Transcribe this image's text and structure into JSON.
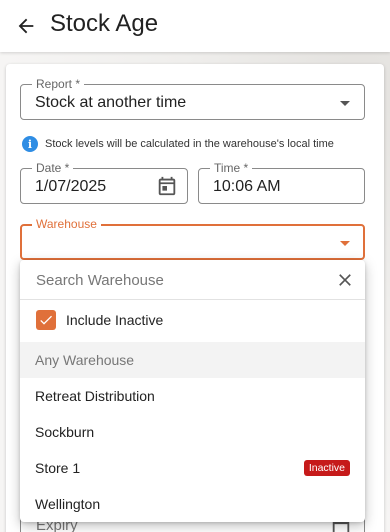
{
  "header": {
    "title": "Stock Age"
  },
  "report": {
    "label": "Report *",
    "value": "Stock at another time"
  },
  "info": {
    "text": "Stock levels will be calculated in the warehouse's local time"
  },
  "date": {
    "label": "Date *",
    "value": "1/07/2025"
  },
  "time": {
    "label": "Time *",
    "value": "10:06 AM"
  },
  "warehouse": {
    "label": "Warehouse",
    "value": ""
  },
  "dropdown": {
    "search_placeholder": "Search Warehouse",
    "include_inactive_label": "Include Inactive",
    "include_inactive_checked": true,
    "items": [
      {
        "label": "Any Warehouse",
        "badge": ""
      },
      {
        "label": "Retreat Distribution",
        "badge": ""
      },
      {
        "label": "Sockburn",
        "badge": ""
      },
      {
        "label": "Store 1",
        "badge": "Inactive"
      },
      {
        "label": "Wellington",
        "badge": ""
      }
    ]
  },
  "expiry": {
    "label": "Expiry"
  },
  "colors": {
    "accent": "#e0703a",
    "info": "#2f8de4",
    "badge": "#c61a1a"
  }
}
